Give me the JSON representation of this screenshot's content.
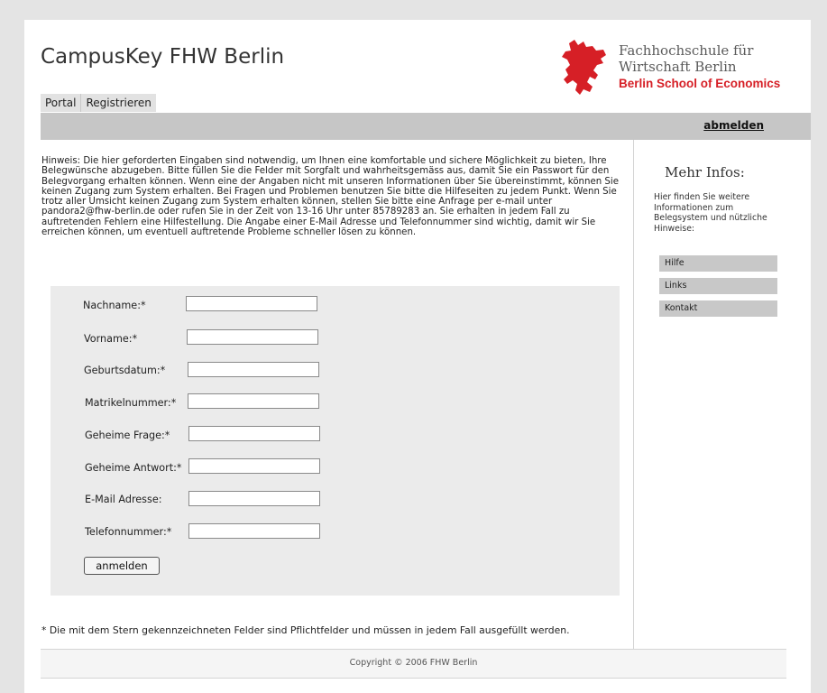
{
  "header": {
    "app_title": "CampusKey FHW Berlin",
    "logo": {
      "line1": "Fachhochschule für",
      "line2": "Wirtschaft Berlin",
      "line3": "Berlin School of Economics",
      "icon": "berlin-bear-icon",
      "accent_color": "#d61f26"
    }
  },
  "tabs": [
    {
      "label": "Portal"
    },
    {
      "label": "Registrieren"
    }
  ],
  "topbar": {
    "logout_label": "abmelden"
  },
  "main": {
    "notice": "Hinweis: Die hier geforderten Eingaben sind notwendig, um Ihnen eine komfortable und sichere Möglichkeit zu bieten, Ihre Belegwünsche abzugeben. Bitte füllen Sie die Felder mit Sorgfalt und wahrheitsgemäss aus, damit Sie ein Passwort für den Belegvorgang erhalten können. Wenn eine der Angaben nicht mit unseren Informationen über Sie übereinstimmt, können Sie keinen Zugang zum System erhalten. Bei Fragen und Problemen benutzen Sie bitte die Hilfeseiten zu jedem Punkt. Wenn Sie trotz aller Umsicht keinen Zugang zum System erhalten können, stellen Sie bitte eine Anfrage per e-mail unter pandora2@fhw-berlin.de oder rufen Sie in der Zeit von 13-16 Uhr unter 85789283 an. Sie erhalten in jedem Fall zu auftretenden Fehlern eine Hilfestellung. Die Angabe einer E-Mail Adresse und Telefonnummer sind wichtig, damit wir Sie erreichen können, um eventuell auftretende Probleme schneller lösen zu können.",
    "form": {
      "fields": [
        {
          "label": "Nachname:*",
          "value": ""
        },
        {
          "label": "Vorname:*",
          "value": ""
        },
        {
          "label": "Geburtsdatum:*",
          "value": ""
        },
        {
          "label": "Matrikelnummer:*",
          "value": ""
        },
        {
          "label": "Geheime Frage:*",
          "value": ""
        },
        {
          "label": "Geheime Antwort:*",
          "value": ""
        },
        {
          "label": "E-Mail Adresse:",
          "value": ""
        },
        {
          "label": "Telefonnummer:*",
          "value": ""
        }
      ],
      "submit_label": "anmelden"
    },
    "footnote": "* Die mit dem Stern gekennzeichneten Felder sind Pflichtfelder und müssen in jedem Fall ausgefüllt werden."
  },
  "sidebar": {
    "title": "Mehr Infos:",
    "description": "Hier finden Sie weitere Informationen zum Belegsystem und nützliche Hinweise:",
    "items": [
      {
        "label": "Hilfe"
      },
      {
        "label": "Links"
      },
      {
        "label": "Kontakt"
      }
    ]
  },
  "footer": {
    "copyright": "Copyright © 2006 FHW Berlin"
  }
}
